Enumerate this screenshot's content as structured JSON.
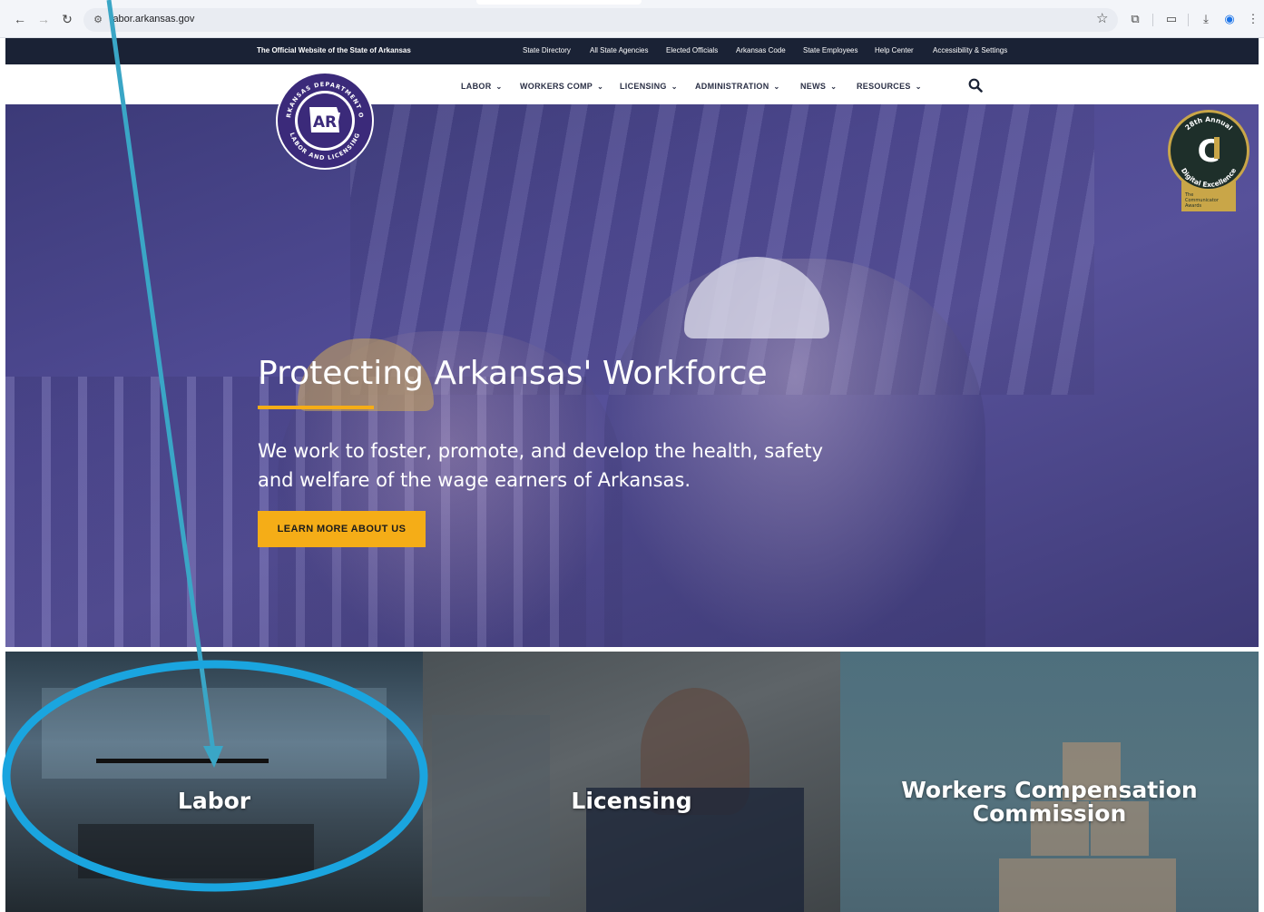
{
  "browser": {
    "url": "labor.arkansas.gov"
  },
  "utility_bar": {
    "official_text": "The Official Website of the State of Arkansas",
    "links": [
      "State Directory",
      "All State Agencies",
      "Elected Officials",
      "Arkansas Code",
      "State Employees",
      "Help Center",
      "Accessibility & Settings"
    ]
  },
  "logo": {
    "ring_text_top": "ARKANSAS DEPARTMENT OF",
    "ring_text_bottom": "LABOR AND LICENSING",
    "mark": "AR"
  },
  "main_nav": {
    "items": [
      "LABOR",
      "WORKERS COMP",
      "LICENSING",
      "ADMINISTRATION",
      "NEWS",
      "RESOURCES"
    ]
  },
  "hero": {
    "title": "Protecting Arkansas' Workforce",
    "subtitle": "We work to foster, promote, and develop the health, safety and welfare of the wage earners of Arkansas.",
    "cta": "LEARN MORE ABOUT US"
  },
  "award": {
    "arc_top": "28th Annual",
    "arc_bottom": "Digital Excellence",
    "mark": "C",
    "caption": [
      "The",
      "Communicator",
      "Awards"
    ]
  },
  "cards": [
    {
      "label": "Labor"
    },
    {
      "label": "Licensing"
    },
    {
      "label": "Workers Compensation Commission"
    }
  ],
  "colors": {
    "accent": "#f5ad17",
    "utility_bg": "#1a2235",
    "annotation": "#1aa5df",
    "arrow": "#3aa6c6"
  }
}
